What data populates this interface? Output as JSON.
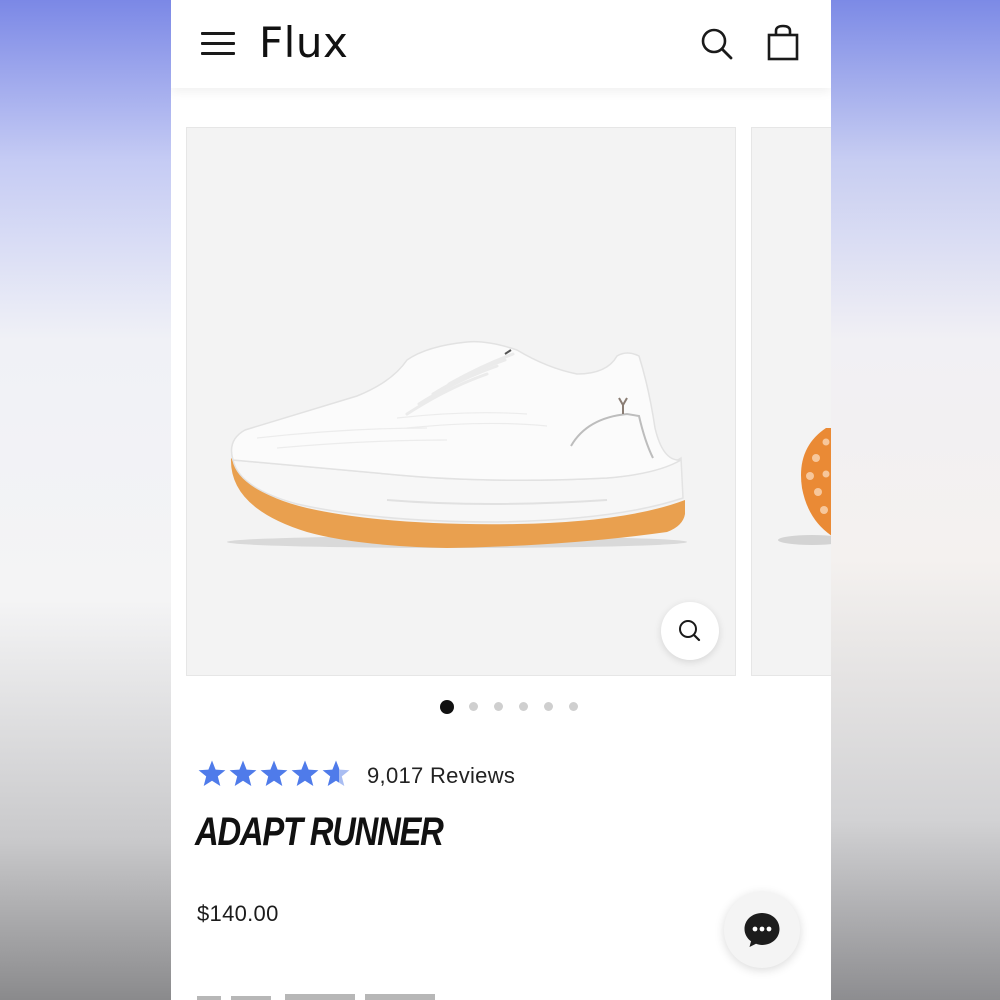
{
  "header": {
    "brand": "Flux",
    "menu_icon": "hamburger-menu-icon",
    "search_icon": "search-icon",
    "bag_icon": "shopping-bag-icon"
  },
  "gallery": {
    "main_image": "white knit running shoe with orange sole, side view",
    "peek_image": "orange sole of shoe, partially visible",
    "zoom_icon": "zoom-magnifier-icon",
    "slide_count": 6,
    "active_slide": 1
  },
  "product": {
    "rating": 4.8,
    "rating_max": 5,
    "reviews_label": "9,017 Reviews",
    "name": "ADAPT RUNNER",
    "price": "$140.00"
  },
  "chat": {
    "icon": "chat-bubble-icon"
  },
  "colors": {
    "star": "#4f7bea",
    "sole": "#e9a04f",
    "accent": "#111111"
  }
}
